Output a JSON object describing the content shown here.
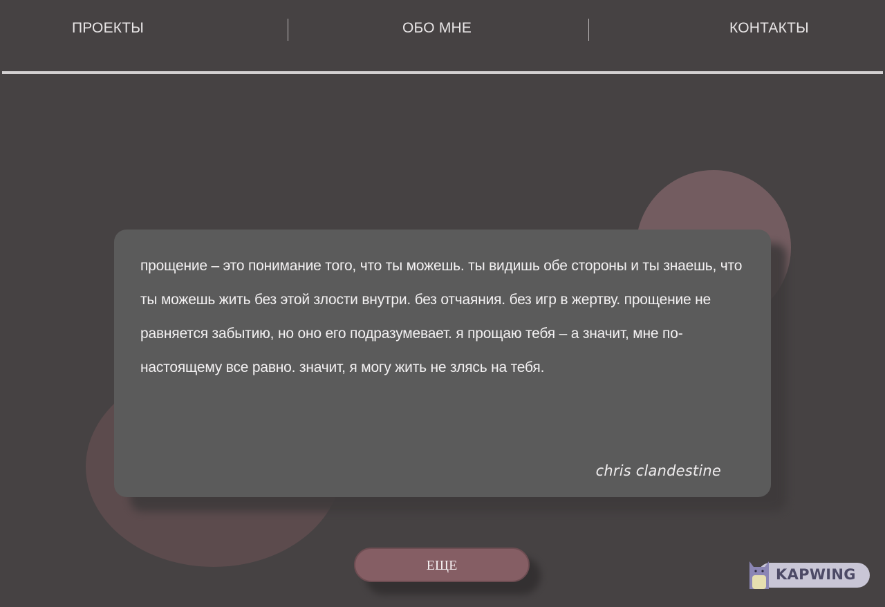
{
  "nav": {
    "items": [
      {
        "label": "ПРОЕКТЫ"
      },
      {
        "label": "ОБО МНЕ"
      },
      {
        "label": "КОНТАКТЫ"
      }
    ]
  },
  "quote": {
    "text": "прощение – это понимание того, что ты можешь. ты видишь обе стороны и ты знаешь, что ты можешь жить без этой злости внутри. без отчаяния. без игр в жертву. прощение не равняется забытию, но оно его подразумевает. я прощаю тебя – а значит, мне по-настоящему все равно. значит, я могу жить не злясь на тебя.",
    "author": "chris clandestine"
  },
  "more_button": {
    "label": "ЕЩЕ"
  },
  "watermark": {
    "text": "KAPWING"
  },
  "colors": {
    "background": "#464243",
    "card": "#5b5b5b",
    "button": "#855e64",
    "circle": "#735c60"
  }
}
